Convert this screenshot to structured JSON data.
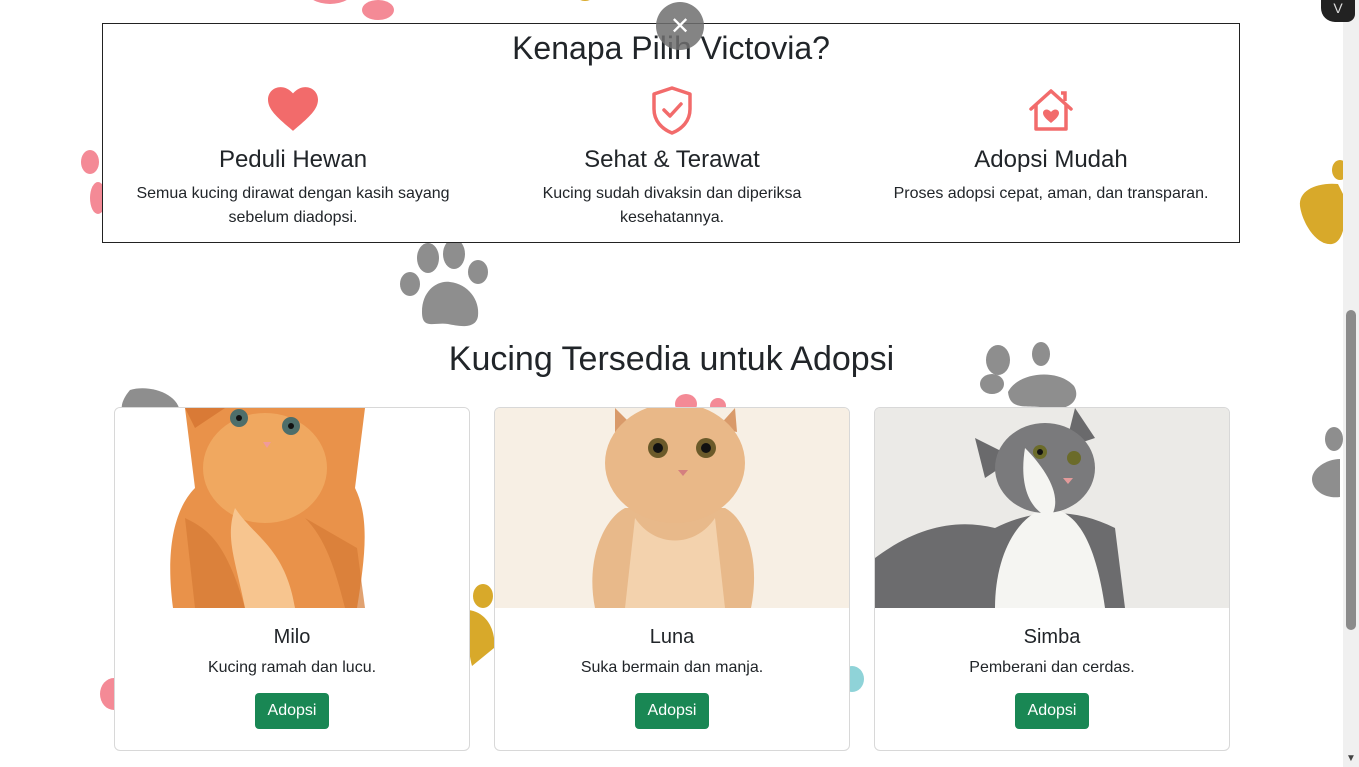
{
  "why": {
    "title": "Kenapa Pilih Victovia?",
    "features": [
      {
        "icon": "heart-icon",
        "title": "Peduli Hewan",
        "desc": "Semua kucing dirawat dengan kasih sayang sebelum diadopsi."
      },
      {
        "icon": "shield-check-icon",
        "title": "Sehat & Terawat",
        "desc": "Kucing sudah divaksin dan diperiksa kesehatannya."
      },
      {
        "icon": "house-heart-icon",
        "title": "Adopsi Mudah",
        "desc": "Proses adopsi cepat, aman, dan transparan."
      }
    ]
  },
  "close": {
    "label": "✕"
  },
  "available": {
    "title": "Kucing Tersedia untuk Adopsi",
    "cats": [
      {
        "name": "Milo",
        "desc": "Kucing ramah dan lucu.",
        "button": "Adopsi"
      },
      {
        "name": "Luna",
        "desc": "Suka bermain dan manja.",
        "button": "Adopsi"
      },
      {
        "name": "Simba",
        "desc": "Pemberani dan cerdas.",
        "button": "Adopsi"
      }
    ]
  },
  "colors": {
    "accent": "#f26b6b",
    "button": "#198754",
    "paw_gray": "#8e8e8e",
    "paw_pink": "#f48a96",
    "paw_gold": "#d8a92a",
    "paw_teal": "#8fd3d8"
  },
  "corner_badge": "V"
}
